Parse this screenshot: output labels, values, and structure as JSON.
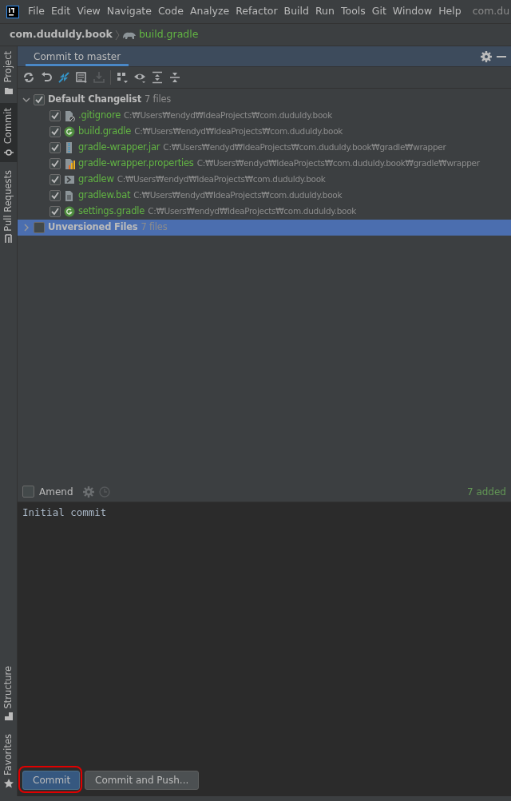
{
  "menu_bar": {
    "items": [
      "File",
      "Edit",
      "View",
      "Navigate",
      "Code",
      "Analyze",
      "Refactor",
      "Build",
      "Run",
      "Tools",
      "Git",
      "Window",
      "Help"
    ],
    "title": "com.du"
  },
  "breadcrumb": [
    {
      "label": "com.duduldy.book",
      "kind": "project"
    },
    {
      "label": "build.gradle",
      "kind": "file"
    }
  ],
  "top_side_tabs": [
    {
      "label": "Project",
      "kind": "folder",
      "selected": false
    },
    {
      "label": "Commit",
      "kind": "commit",
      "selected": true
    },
    {
      "label": "Pull Requests",
      "kind": "pull",
      "selected": false
    }
  ],
  "bottom_side_tabs": [
    {
      "label": "Structure",
      "kind": "structure",
      "selected": false
    },
    {
      "label": "Favorites",
      "kind": "star",
      "selected": false
    }
  ],
  "tool_window": {
    "title": "Commit to master"
  },
  "toolbar": [
    {
      "kind": "refresh",
      "disabled": false
    },
    {
      "kind": "rollback",
      "disabled": false
    },
    {
      "kind": "diff",
      "disabled": false
    },
    {
      "kind": "changelist",
      "disabled": false
    },
    {
      "kind": "shelve",
      "disabled": true
    },
    {
      "kind": "group",
      "disabled": false
    },
    {
      "kind": "eye",
      "disabled": false
    },
    {
      "kind": "expand",
      "disabled": false
    },
    {
      "kind": "collapse",
      "disabled": false
    }
  ],
  "changelists": [
    {
      "name": "Default Changelist",
      "count": "7 files",
      "expanded": true,
      "checked": true,
      "selected": false,
      "files": [
        {
          "name": ".gitignore",
          "kind": "gitignore",
          "path": "C:₩Users₩endyd₩IdeaProjects₩com.duduldy.book",
          "checked": true
        },
        {
          "name": "build.gradle",
          "kind": "gradle",
          "path": "C:₩Users₩endyd₩IdeaProjects₩com.duduldy.book",
          "checked": true
        },
        {
          "name": "gradle-wrapper.jar",
          "kind": "jar",
          "path": "C:₩Users₩endyd₩IdeaProjects₩com.duduldy.book₩gradle₩wrapper",
          "checked": true
        },
        {
          "name": "gradle-wrapper.properties",
          "kind": "properties",
          "path": "C:₩Users₩endyd₩IdeaProjects₩com.duduldy.book₩gradle₩wrapper",
          "checked": true
        },
        {
          "name": "gradlew",
          "kind": "script",
          "path": "C:₩Users₩endyd₩IdeaProjects₩com.duduldy.book",
          "checked": true
        },
        {
          "name": "gradlew.bat",
          "kind": "text",
          "path": "C:₩Users₩endyd₩IdeaProjects₩com.duduldy.book",
          "checked": true
        },
        {
          "name": "settings.gradle",
          "kind": "gradle",
          "path": "C:₩Users₩endyd₩IdeaProjects₩com.duduldy.book",
          "checked": true
        }
      ]
    },
    {
      "name": "Unversioned Files",
      "count": "7 files",
      "expanded": false,
      "checked": false,
      "selected": true
    }
  ],
  "amend": {
    "label": "Amend",
    "checked": false
  },
  "summary": "7 added",
  "commit_message": "Initial commit",
  "buttons": [
    {
      "label": "Commit",
      "kind": "primary",
      "annotated": true
    },
    {
      "label": "Commit and Push...",
      "kind": "secondary",
      "annotated": false
    }
  ]
}
